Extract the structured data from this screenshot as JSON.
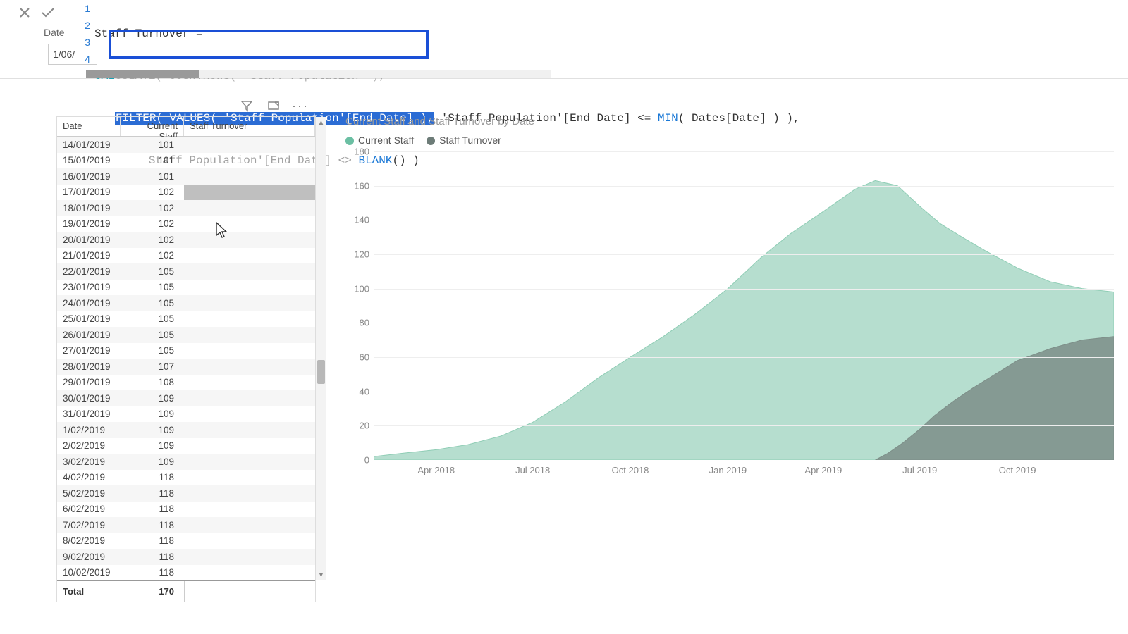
{
  "formula": {
    "measure_name": "Staff Turnover =",
    "line2_pre": "CAL",
    "line2_mid_obscured": "CULATE( COUNTROWS( 'Staff Population' ),",
    "line3_sel": "FILTER( VALUES( 'Staff Population'[End Date] ),",
    "line3_post": " 'Staff Population'[End Date] <= ",
    "line3_min": "MIN",
    "line3_tail": "( Dates[Date] ) ),",
    "line4_pre_obscured": "Staff Population'[End Date] <> ",
    "line4_blank": "BLANK",
    "line4_tail": "() )",
    "gutter": [
      "1",
      "2",
      "3",
      "4"
    ],
    "date_label": "Date",
    "date_cell": "1/06/"
  },
  "table": {
    "headers": {
      "date": "Date",
      "cs": "Current Staff",
      "st": "Staff Turnover"
    },
    "rows": [
      {
        "d": "14/01/2019",
        "v": "101"
      },
      {
        "d": "15/01/2019",
        "v": "101"
      },
      {
        "d": "16/01/2019",
        "v": "101"
      },
      {
        "d": "17/01/2019",
        "v": "102",
        "sel": true
      },
      {
        "d": "18/01/2019",
        "v": "102"
      },
      {
        "d": "19/01/2019",
        "v": "102"
      },
      {
        "d": "20/01/2019",
        "v": "102"
      },
      {
        "d": "21/01/2019",
        "v": "102"
      },
      {
        "d": "22/01/2019",
        "v": "105"
      },
      {
        "d": "23/01/2019",
        "v": "105"
      },
      {
        "d": "24/01/2019",
        "v": "105"
      },
      {
        "d": "25/01/2019",
        "v": "105"
      },
      {
        "d": "26/01/2019",
        "v": "105"
      },
      {
        "d": "27/01/2019",
        "v": "105"
      },
      {
        "d": "28/01/2019",
        "v": "107"
      },
      {
        "d": "29/01/2019",
        "v": "108"
      },
      {
        "d": "30/01/2019",
        "v": "109"
      },
      {
        "d": "31/01/2019",
        "v": "109"
      },
      {
        "d": "1/02/2019",
        "v": "109"
      },
      {
        "d": "2/02/2019",
        "v": "109"
      },
      {
        "d": "3/02/2019",
        "v": "109"
      },
      {
        "d": "4/02/2019",
        "v": "118"
      },
      {
        "d": "5/02/2019",
        "v": "118"
      },
      {
        "d": "6/02/2019",
        "v": "118"
      },
      {
        "d": "7/02/2019",
        "v": "118"
      },
      {
        "d": "8/02/2019",
        "v": "118"
      },
      {
        "d": "9/02/2019",
        "v": "118"
      },
      {
        "d": "10/02/2019",
        "v": "118"
      }
    ],
    "total_label": "Total",
    "total_value": "170"
  },
  "chart_data": {
    "type": "area",
    "title": "Current Staff and Staff Turnover by Date",
    "legend": [
      "Current Staff",
      "Staff Turnover"
    ],
    "ylabel": "",
    "xlabel": "",
    "ylim": [
      0,
      180
    ],
    "yticks": [
      0,
      20,
      40,
      60,
      80,
      100,
      120,
      140,
      160,
      180
    ],
    "xticks": [
      "Apr 2018",
      "Jul 2018",
      "Oct 2018",
      "Jan 2019",
      "Apr 2019",
      "Jul 2019",
      "Oct 2019"
    ],
    "x_range": [
      "2018-02-01",
      "2019-12-31"
    ],
    "series": [
      {
        "name": "Current Staff",
        "color": "#8fcdb5",
        "points": [
          {
            "x": "2018-02-01",
            "y": 2
          },
          {
            "x": "2018-03-01",
            "y": 4
          },
          {
            "x": "2018-04-01",
            "y": 6
          },
          {
            "x": "2018-05-01",
            "y": 9
          },
          {
            "x": "2018-06-01",
            "y": 14
          },
          {
            "x": "2018-07-01",
            "y": 22
          },
          {
            "x": "2018-08-01",
            "y": 34
          },
          {
            "x": "2018-09-01",
            "y": 48
          },
          {
            "x": "2018-10-01",
            "y": 60
          },
          {
            "x": "2018-11-01",
            "y": 72
          },
          {
            "x": "2018-12-01",
            "y": 85
          },
          {
            "x": "2019-01-01",
            "y": 100
          },
          {
            "x": "2019-02-01",
            "y": 118
          },
          {
            "x": "2019-03-01",
            "y": 132
          },
          {
            "x": "2019-04-01",
            "y": 145
          },
          {
            "x": "2019-05-01",
            "y": 158
          },
          {
            "x": "2019-05-20",
            "y": 163
          },
          {
            "x": "2019-06-10",
            "y": 160
          },
          {
            "x": "2019-07-01",
            "y": 148
          },
          {
            "x": "2019-07-20",
            "y": 138
          },
          {
            "x": "2019-08-10",
            "y": 130
          },
          {
            "x": "2019-09-01",
            "y": 122
          },
          {
            "x": "2019-10-01",
            "y": 112
          },
          {
            "x": "2019-11-01",
            "y": 104
          },
          {
            "x": "2019-12-01",
            "y": 100
          },
          {
            "x": "2019-12-31",
            "y": 98
          }
        ]
      },
      {
        "name": "Staff Turnover",
        "color": "#7d8e88",
        "points": [
          {
            "x": "2019-05-20",
            "y": 0
          },
          {
            "x": "2019-06-01",
            "y": 4
          },
          {
            "x": "2019-06-15",
            "y": 10
          },
          {
            "x": "2019-07-01",
            "y": 18
          },
          {
            "x": "2019-07-15",
            "y": 26
          },
          {
            "x": "2019-08-01",
            "y": 34
          },
          {
            "x": "2019-08-20",
            "y": 42
          },
          {
            "x": "2019-09-10",
            "y": 50
          },
          {
            "x": "2019-10-01",
            "y": 58
          },
          {
            "x": "2019-11-01",
            "y": 65
          },
          {
            "x": "2019-12-01",
            "y": 70
          },
          {
            "x": "2019-12-31",
            "y": 72
          }
        ]
      }
    ]
  }
}
